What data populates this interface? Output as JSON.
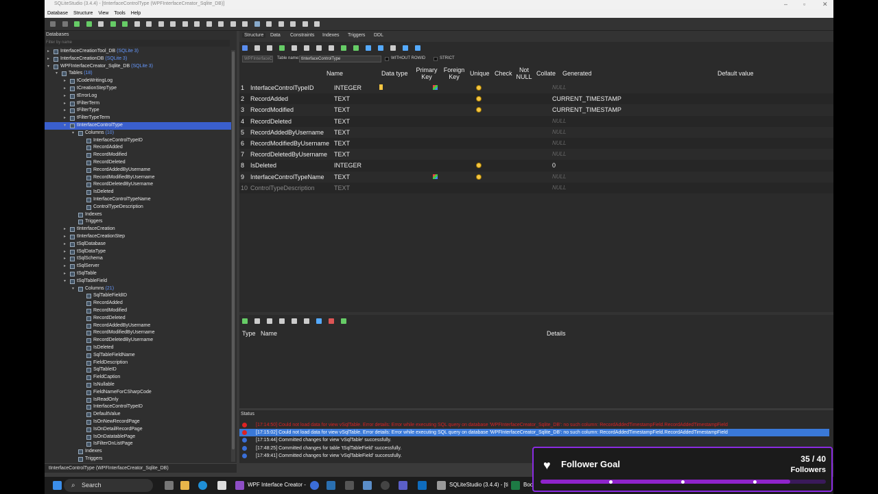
{
  "window": {
    "title": "SQLiteStudio (3.4.4) - [tInterfaceControlType (WPFInterfaceCreator_Sqlite_DB)]"
  },
  "menu": [
    "Database",
    "Structure",
    "View",
    "Tools",
    "Help"
  ],
  "db_panel": {
    "header": "Databases",
    "filter_placeholder": "Filter by name",
    "tree": [
      {
        "indent": 0,
        "arrow": "▸",
        "label": "InterfaceCreationTool_DB",
        "sub": "(SQLite 3)"
      },
      {
        "indent": 0,
        "arrow": "▸",
        "label": "InterfaceCreationDB",
        "sub": "(SQLite 3)"
      },
      {
        "indent": 0,
        "arrow": "▾",
        "label": "WPFInterfaceCreator_Sqlite_DB",
        "sub": "(SQLite 3)"
      },
      {
        "indent": 1,
        "arrow": "▾",
        "label": "Tables",
        "sub": "(18)"
      },
      {
        "indent": 2,
        "arrow": "▸",
        "label": "tCodeWritingLog",
        "sub": ""
      },
      {
        "indent": 2,
        "arrow": "▸",
        "label": "tCreationStepType",
        "sub": ""
      },
      {
        "indent": 2,
        "arrow": "▸",
        "label": "tErrorLog",
        "sub": ""
      },
      {
        "indent": 2,
        "arrow": "▸",
        "label": "tFilterTerm",
        "sub": ""
      },
      {
        "indent": 2,
        "arrow": "▸",
        "label": "tFilterType",
        "sub": ""
      },
      {
        "indent": 2,
        "arrow": "▸",
        "label": "tFilterTypeTerm",
        "sub": ""
      },
      {
        "indent": 2,
        "arrow": "▾",
        "label": "tInterfaceControlType",
        "sub": "",
        "selected": true
      },
      {
        "indent": 3,
        "arrow": "▾",
        "label": "Columns",
        "sub": "(10)"
      },
      {
        "indent": 4,
        "arrow": "",
        "label": "InterfaceControlTypeID",
        "sub": ""
      },
      {
        "indent": 4,
        "arrow": "",
        "label": "RecordAdded",
        "sub": ""
      },
      {
        "indent": 4,
        "arrow": "",
        "label": "RecordModified",
        "sub": ""
      },
      {
        "indent": 4,
        "arrow": "",
        "label": "RecordDeleted",
        "sub": ""
      },
      {
        "indent": 4,
        "arrow": "",
        "label": "RecordAddedByUsername",
        "sub": ""
      },
      {
        "indent": 4,
        "arrow": "",
        "label": "RecordModifiedByUsername",
        "sub": ""
      },
      {
        "indent": 4,
        "arrow": "",
        "label": "RecordDeletedByUsername",
        "sub": ""
      },
      {
        "indent": 4,
        "arrow": "",
        "label": "IsDeleted",
        "sub": ""
      },
      {
        "indent": 4,
        "arrow": "",
        "label": "InterfaceControlTypeName",
        "sub": ""
      },
      {
        "indent": 4,
        "arrow": "",
        "label": "ControlTypeDescription",
        "sub": ""
      },
      {
        "indent": 3,
        "arrow": "",
        "label": "Indexes",
        "sub": ""
      },
      {
        "indent": 3,
        "arrow": "",
        "label": "Triggers",
        "sub": ""
      },
      {
        "indent": 2,
        "arrow": "▸",
        "label": "tInterfaceCreation",
        "sub": ""
      },
      {
        "indent": 2,
        "arrow": "▸",
        "label": "tInterfaceCreationStep",
        "sub": ""
      },
      {
        "indent": 2,
        "arrow": "▸",
        "label": "tSqlDatabase",
        "sub": ""
      },
      {
        "indent": 2,
        "arrow": "▸",
        "label": "tSqlDataType",
        "sub": ""
      },
      {
        "indent": 2,
        "arrow": "▸",
        "label": "tSqlSchema",
        "sub": ""
      },
      {
        "indent": 2,
        "arrow": "▸",
        "label": "tSqlServer",
        "sub": ""
      },
      {
        "indent": 2,
        "arrow": "▸",
        "label": "tSqlTable",
        "sub": ""
      },
      {
        "indent": 2,
        "arrow": "▾",
        "label": "tSqlTableField",
        "sub": ""
      },
      {
        "indent": 3,
        "arrow": "▾",
        "label": "Columns",
        "sub": "(21)"
      },
      {
        "indent": 4,
        "arrow": "",
        "label": "SqlTableFieldID",
        "sub": ""
      },
      {
        "indent": 4,
        "arrow": "",
        "label": "RecordAdded",
        "sub": ""
      },
      {
        "indent": 4,
        "arrow": "",
        "label": "RecordModified",
        "sub": ""
      },
      {
        "indent": 4,
        "arrow": "",
        "label": "RecordDeleted",
        "sub": ""
      },
      {
        "indent": 4,
        "arrow": "",
        "label": "RecordAddedByUsername",
        "sub": ""
      },
      {
        "indent": 4,
        "arrow": "",
        "label": "RecordModifiedByUsername",
        "sub": ""
      },
      {
        "indent": 4,
        "arrow": "",
        "label": "RecordDeletedByUsername",
        "sub": ""
      },
      {
        "indent": 4,
        "arrow": "",
        "label": "IsDeleted",
        "sub": ""
      },
      {
        "indent": 4,
        "arrow": "",
        "label": "SqlTableFieldName",
        "sub": ""
      },
      {
        "indent": 4,
        "arrow": "",
        "label": "FieldDescription",
        "sub": ""
      },
      {
        "indent": 4,
        "arrow": "",
        "label": "SqlTableID",
        "sub": ""
      },
      {
        "indent": 4,
        "arrow": "",
        "label": "FieldCaption",
        "sub": ""
      },
      {
        "indent": 4,
        "arrow": "",
        "label": "IsNullable",
        "sub": ""
      },
      {
        "indent": 4,
        "arrow": "",
        "label": "FieldNameForCSharpCode",
        "sub": ""
      },
      {
        "indent": 4,
        "arrow": "",
        "label": "IsReadOnly",
        "sub": ""
      },
      {
        "indent": 4,
        "arrow": "",
        "label": "InterfaceControlTypeID",
        "sub": ""
      },
      {
        "indent": 4,
        "arrow": "",
        "label": "DefaultValue",
        "sub": ""
      },
      {
        "indent": 4,
        "arrow": "",
        "label": "IsOnNewRecordPage",
        "sub": ""
      },
      {
        "indent": 4,
        "arrow": "",
        "label": "IsOnDetailRecordPage",
        "sub": ""
      },
      {
        "indent": 4,
        "arrow": "",
        "label": "IsOnDatatablePage",
        "sub": ""
      },
      {
        "indent": 4,
        "arrow": "",
        "label": "IsFilterOnListPage",
        "sub": ""
      },
      {
        "indent": 3,
        "arrow": "",
        "label": "Indexes",
        "sub": ""
      },
      {
        "indent": 3,
        "arrow": "",
        "label": "Triggers",
        "sub": ""
      }
    ],
    "bottom_tab": "tInterfaceControlType (WPFInterfaceCreator_Sqlite_DB)"
  },
  "editor": {
    "tabs": [
      "Structure",
      "Data",
      "Constraints",
      "Indexes",
      "Triggers",
      "DDL"
    ],
    "db_combo": "WPFInterfaceC",
    "table_name_label": "Table name:",
    "table_name": "tInterfaceControlType",
    "without_rowid": "WITHOUT ROWID",
    "strict": "STRICT",
    "columns_header": {
      "name": "Name",
      "datatype": "Data type",
      "pk1": "Primary",
      "pk2": "Key",
      "fk1": "Foreign",
      "fk2": "Key",
      "unique": "Unique",
      "check": "Check",
      "nn1": "Not",
      "nn2": "NULL",
      "collate": "Collate",
      "generated": "Generated",
      "default": "Default value"
    },
    "rows": [
      {
        "n": "1",
        "name": "InterfaceControlTypeID",
        "type": "INTEGER",
        "pk": true,
        "unique": true,
        "notnull": true,
        "default": "NULL",
        "null": true
      },
      {
        "n": "2",
        "name": "RecordAdded",
        "type": "TEXT",
        "pk": false,
        "unique": false,
        "notnull": true,
        "default": "CURRENT_TIMESTAMP",
        "null": false
      },
      {
        "n": "3",
        "name": "RecordModified",
        "type": "TEXT",
        "pk": false,
        "unique": false,
        "notnull": true,
        "default": "CURRENT_TIMESTAMP",
        "null": false
      },
      {
        "n": "4",
        "name": "RecordDeleted",
        "type": "TEXT",
        "pk": false,
        "unique": false,
        "notnull": false,
        "default": "NULL",
        "null": true
      },
      {
        "n": "5",
        "name": "RecordAddedByUsername",
        "type": "TEXT",
        "pk": false,
        "unique": false,
        "notnull": false,
        "default": "NULL",
        "null": true
      },
      {
        "n": "6",
        "name": "RecordModifiedByUsername",
        "type": "TEXT",
        "pk": false,
        "unique": false,
        "notnull": false,
        "default": "NULL",
        "null": true
      },
      {
        "n": "7",
        "name": "RecordDeletedByUsername",
        "type": "TEXT",
        "pk": false,
        "unique": false,
        "notnull": false,
        "default": "NULL",
        "null": true
      },
      {
        "n": "8",
        "name": "IsDeleted",
        "type": "INTEGER",
        "pk": false,
        "unique": false,
        "notnull": true,
        "default": "0",
        "null": false
      },
      {
        "n": "9",
        "name": "InterfaceControlTypeName",
        "type": "TEXT",
        "pk": false,
        "unique": true,
        "notnull": true,
        "default": "NULL",
        "null": true
      },
      {
        "n": "10",
        "name": "ControlTypeDescription",
        "type": "TEXT",
        "pk": false,
        "unique": false,
        "notnull": false,
        "default": "NULL",
        "null": true
      }
    ],
    "constraints_header": {
      "type": "Type",
      "name": "Name",
      "details": "Details"
    }
  },
  "status": {
    "header": "Status",
    "rows": [
      {
        "kind": "err",
        "text": "[17:14:50] Could not load data for view vSqlTable. Error details: Error while executing SQL query on database 'WPFInterfaceCreator_Sqlite_DB': no such column: RecordAddedTimestampField.RecordAddedTimestampField"
      },
      {
        "kind": "sel",
        "text": "[17:15:02] Could not load data for view vSqlTable. Error details: Error while executing SQL query on database 'WPFInterfaceCreator_Sqlite_DB': no such column: RecordAddedTimestampField.RecordAddedTimestampField"
      },
      {
        "kind": "info",
        "text": "[17:15:44] Committed changes for view 'vSqlTable' successfully."
      },
      {
        "kind": "info",
        "text": "[17:48:25] Committed changes for table 'tSqlTableField' successfully."
      },
      {
        "kind": "info",
        "text": "[17:49:41] Committed changes for view 'vSqlTableField' successfully."
      }
    ]
  },
  "taskbar": {
    "search": "Search",
    "items": [
      "WPF Interface Creator -",
      "SQLiteStudio (3.4.4) - [ti",
      "Boo"
    ]
  },
  "goal": {
    "title": "Follower Goal",
    "count": "35 / 40",
    "label": "Followers",
    "progress": 0.875
  },
  "colors": {
    "accent": "#3a5fcd",
    "error": "#dd2222",
    "goal": "#8e24c9"
  }
}
